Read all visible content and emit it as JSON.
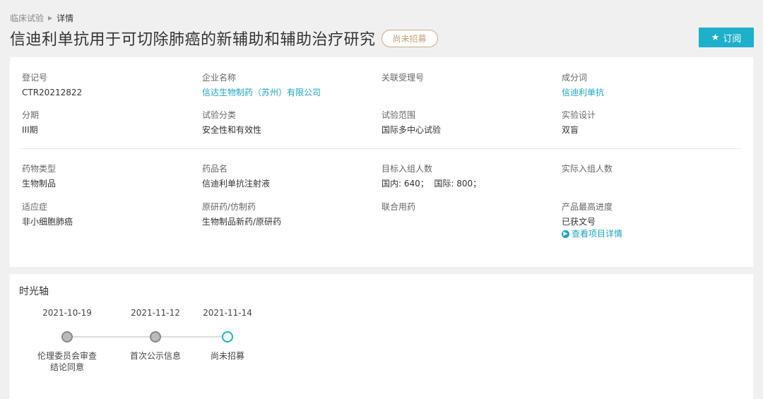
{
  "breadcrumb": {
    "parent": "临床试验",
    "current": "详情"
  },
  "header": {
    "title": "信迪利单抗用于可切除肺癌的新辅助和辅助治疗研究",
    "status": "尚未招募",
    "subscribe_label": "订阅",
    "subscribe_icon": "star-icon"
  },
  "colors": {
    "accent": "#1eafcb",
    "link": "#1aa6c2",
    "badge": "#c2a27a"
  },
  "info": {
    "reg_no": {
      "label": "登记号",
      "value": "CTR20212822"
    },
    "company": {
      "label": "企业名称",
      "value": "信达生物制药（苏州）有限公司"
    },
    "related_no": {
      "label": "关联受理号",
      "value": ""
    },
    "ingredient": {
      "label": "成分词",
      "value": "信迪利单抗"
    },
    "phase": {
      "label": "分期",
      "value": "III期"
    },
    "category": {
      "label": "试验分类",
      "value": "安全性和有效性"
    },
    "scope": {
      "label": "试验范围",
      "value": "国际多中心试验"
    },
    "design": {
      "label": "实验设计",
      "value": "双盲"
    },
    "drug_type": {
      "label": "药物类型",
      "value": "生物制品"
    },
    "drug_name": {
      "label": "药品名",
      "value": "信迪利单抗注射液"
    },
    "target": {
      "label": "目标入组人数",
      "value": "国内: 640；  国际: 800；"
    },
    "actual": {
      "label": "实际入组人数",
      "value": ""
    },
    "indication": {
      "label": "适应症",
      "value": "非小细胞肺癌"
    },
    "origin": {
      "label": "原研药/仿制药",
      "value": "生物制品新药/原研药"
    },
    "combo": {
      "label": "联合用药",
      "value": ""
    },
    "progress": {
      "label": "产品最高进度",
      "value": "已获文号",
      "link": "查看项目详情"
    }
  },
  "timeline": {
    "title": "时光轴",
    "events": [
      {
        "date": "2021-10-19",
        "label_line1": "伦理委员会审查",
        "label_line2": "结论同意",
        "active": false
      },
      {
        "date": "2021-11-12",
        "label_line1": "首次公示信息",
        "label_line2": "",
        "active": false
      },
      {
        "date": "2021-11-14",
        "label_line1": "尚未招募",
        "label_line2": "",
        "active": true
      }
    ]
  }
}
